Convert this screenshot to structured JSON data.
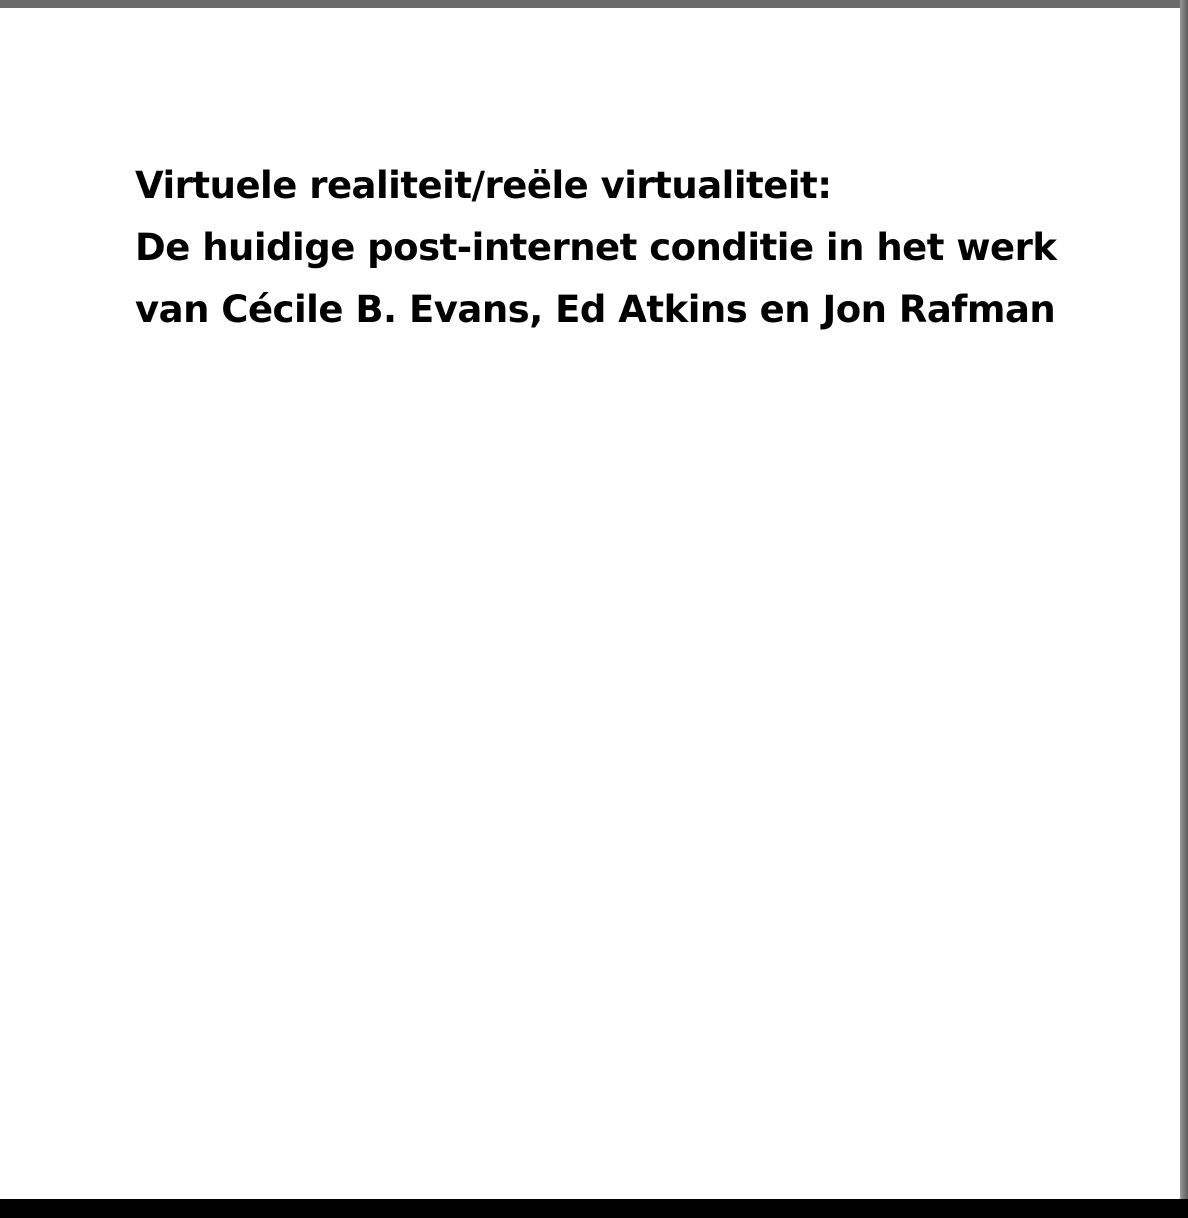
{
  "document": {
    "title_lines": [
      "Virtuele realiteit/reële virtualiteit:",
      "De huidige post-internet conditie in het werk",
      "van Cécile B. Evans, Ed Atkins en Jon Rafman"
    ]
  }
}
